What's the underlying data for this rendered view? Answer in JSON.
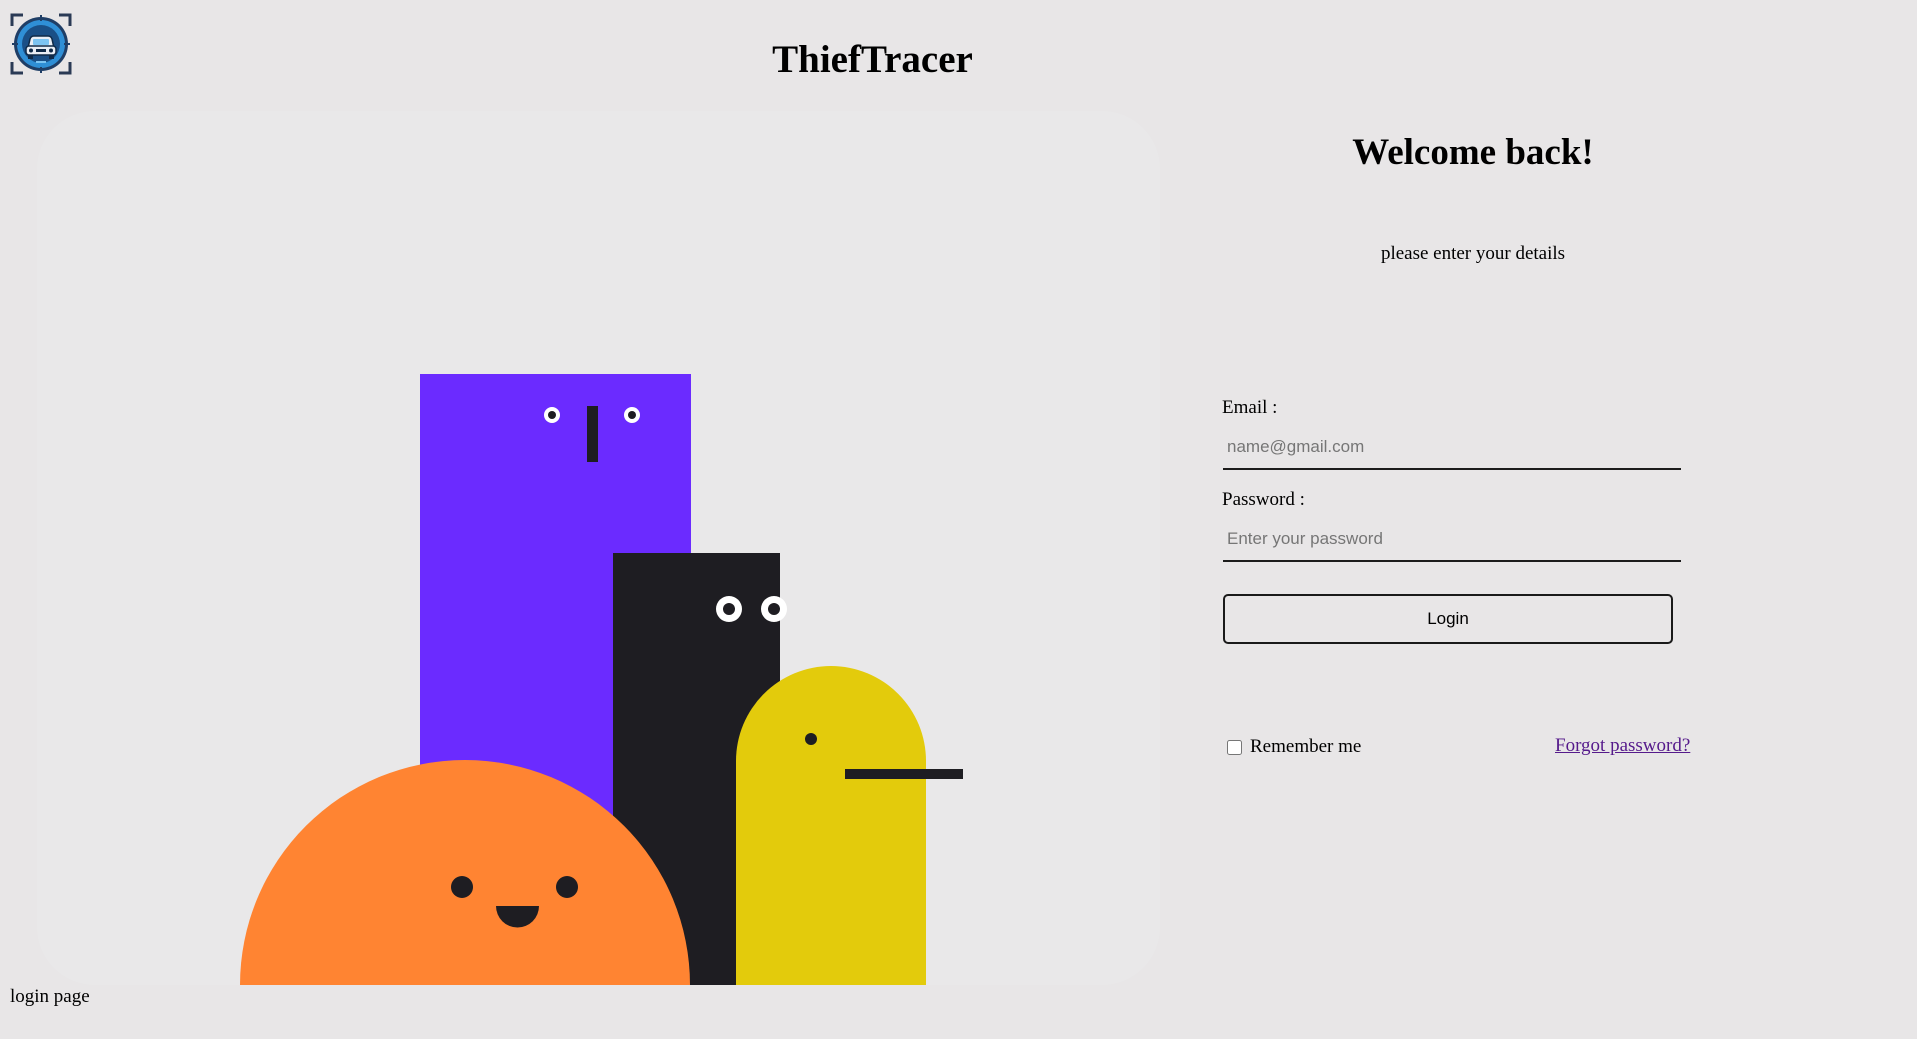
{
  "header": {
    "title": "ThiefTracer",
    "logo_icon": "car-tracker-icon"
  },
  "illustration": {
    "colors": {
      "background": "#e9e8e9",
      "purple": "#6b2bff",
      "black": "#1e1d22",
      "yellow": "#e3cb0c",
      "orange": "#ff8432"
    }
  },
  "login_form": {
    "heading": "Welcome back!",
    "subtitle": "please enter your details",
    "email_label": "Email :",
    "email_placeholder": "name@gmail.com",
    "password_label": "Password :",
    "password_placeholder": "Enter your password",
    "login_button": "Login",
    "remember_label": "Remember me",
    "remember_checked": false,
    "forgot_link": "Forgot password?"
  },
  "footer": {
    "label": "login page"
  },
  "colors": {
    "page_background": "#e8e6e7",
    "link": "#551a8b"
  }
}
